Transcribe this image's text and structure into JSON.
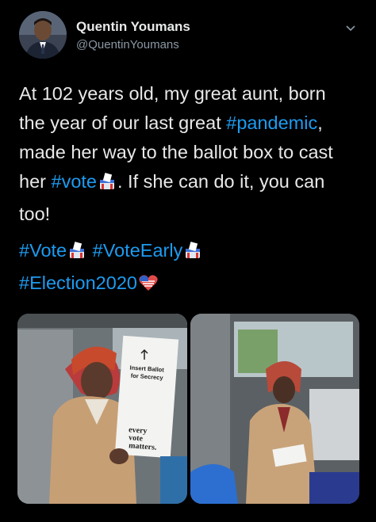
{
  "user": {
    "display_name": "Quentin Youmans",
    "handle": "@QuentinYoumans"
  },
  "tweet": {
    "text_1": "At 102 years old, my great aunt, born\nthe year of our last great ",
    "hashtag_pandemic": "#pandemic",
    "text_2": ",\nmade her way to the ballot box to cast\nher ",
    "hashtag_vote": "#vote",
    "text_3": ". If she can do it, you can\ntoo!",
    "hashtags": [
      "#Vote",
      "#VoteEarly",
      "#Election2020"
    ]
  },
  "media": {
    "photo_1": {
      "card_line_1": "Insert Ballot",
      "card_line_2": "for Secrecy",
      "card_slogan_1": "every",
      "card_slogan_2": "vote",
      "card_slogan_3": "matters."
    },
    "icons": [
      "ballot-box-icon",
      "us-flag-heart-icon",
      "chevron-down-icon"
    ]
  },
  "colors": {
    "background": "#000000",
    "link": "#1d9bf0",
    "text": "#e8e8e8",
    "muted": "#8b98a5"
  }
}
